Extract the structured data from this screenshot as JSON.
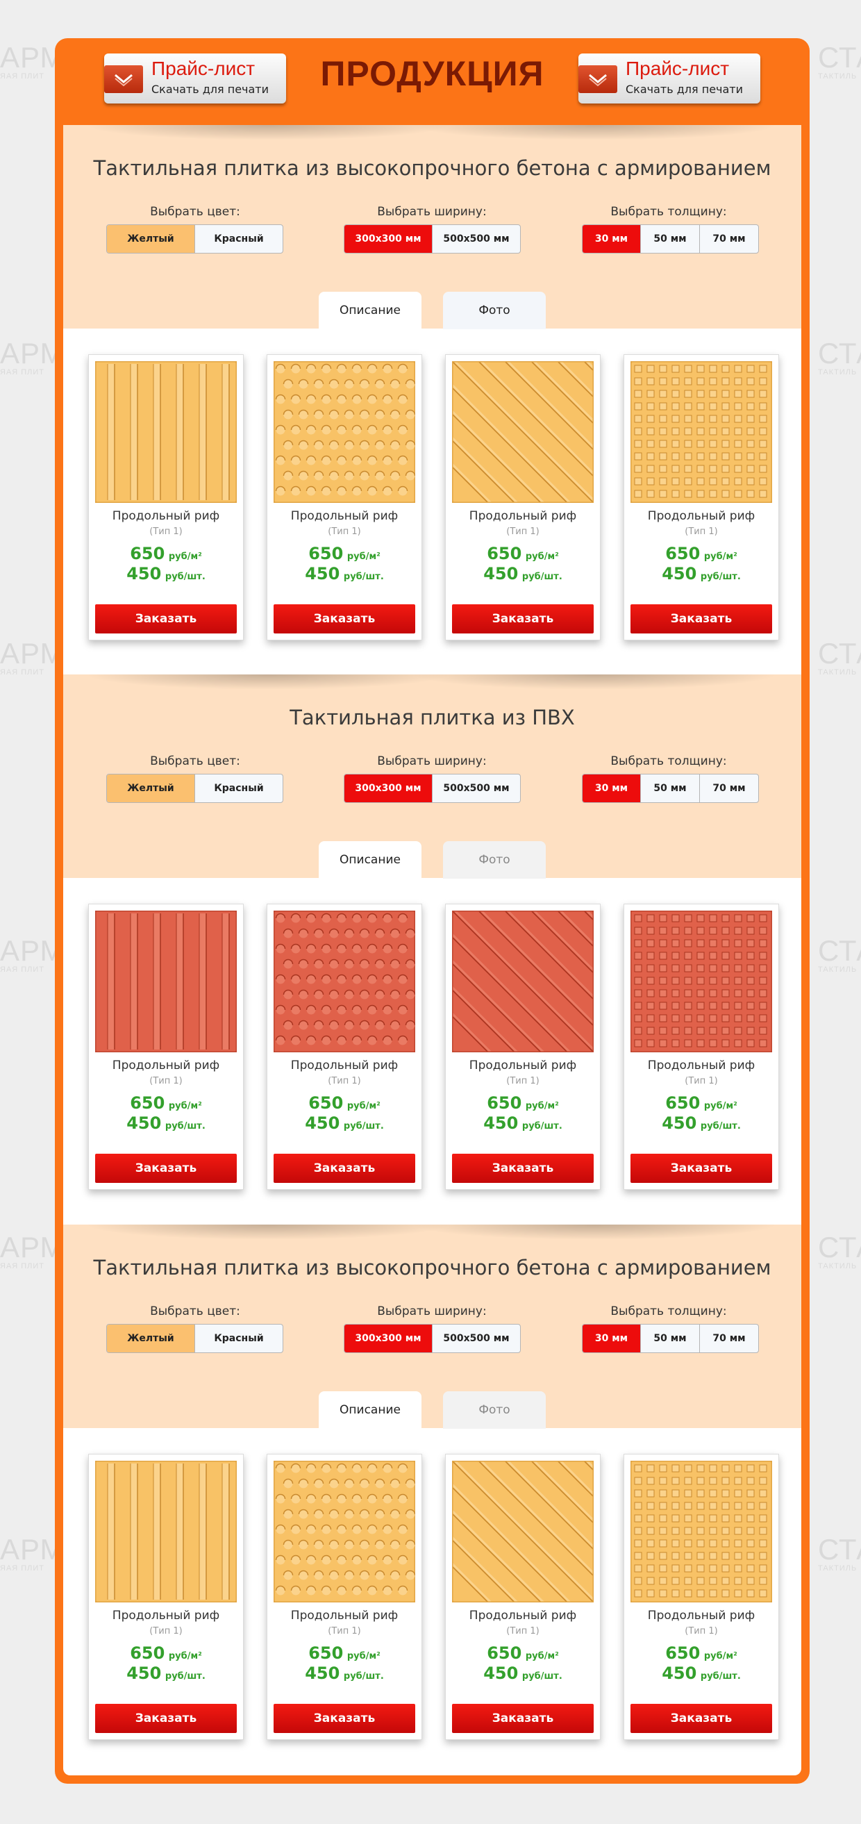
{
  "header": {
    "title": "ПРОДУКЦИЯ",
    "price_button_title": "Прайс-лист",
    "price_button_subtitle": "Скачать для печати"
  },
  "watermark": {
    "left_text": "АРМ",
    "left_sub": "ЯАЯ ПЛИТ",
    "right_text": "СТА",
    "right_sub": "ТАКТИЛЬ"
  },
  "colors": {
    "frame": "#fc7417",
    "band": "#fee0c2",
    "tile_yellow": "#f8c266",
    "tile_red": "#e0614a",
    "price_green": "#33a02c",
    "accent_red": "#ed0c0c"
  },
  "labels": {
    "color": "Выбрать цвет:",
    "width": "Выбрать ширину:",
    "thickness": "Выбрать толщину:"
  },
  "options": {
    "color": [
      "Желтый",
      "Красный"
    ],
    "width": [
      "300х300 мм",
      "500х500 мм"
    ],
    "thickness": [
      "30 мм",
      "50 мм",
      "70 мм"
    ]
  },
  "tabs": [
    "Описание",
    "Фото"
  ],
  "product": {
    "name": "Продольный риф",
    "type": "(Тип 1)",
    "price_m2": "650",
    "unit_m2": "руб/м²",
    "price_pc": "450",
    "unit_pc": "руб/шт.",
    "order": "Заказать"
  },
  "sections": [
    {
      "title": "Тактильная плитка из высокопрочного бетона с армированием",
      "tile_color": "yellow"
    },
    {
      "title": "Тактильная плитка из ПВХ",
      "tile_color": "red"
    },
    {
      "title": "Тактильная плитка из высокопрочного бетона с армированием",
      "tile_color": "yellow"
    }
  ],
  "tile_patterns": [
    "longitudinal-ribs",
    "truncated-domes",
    "diagonal-ribs",
    "square-studs"
  ]
}
